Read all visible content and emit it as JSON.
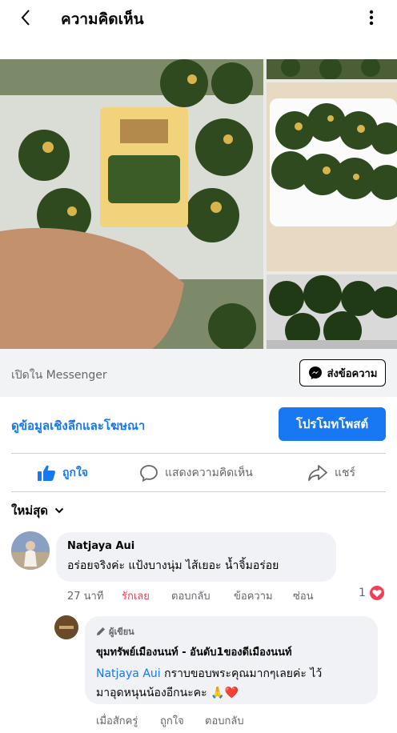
{
  "header": {
    "title": "ความคิดเห็น"
  },
  "messenger": {
    "open_text": "เปิดใน Messenger",
    "send_label": "ส่งข้อความ"
  },
  "promo": {
    "insights_label": "ดูข้อมูลเชิงลึกและโฆษณา",
    "promote_label": "โปรโมทโพสต์"
  },
  "actions": {
    "like": "ถูกใจ",
    "comment": "แสดงความคิดเห็น",
    "share": "แชร์"
  },
  "sort": {
    "label": "ใหม่สุด"
  },
  "comment1": {
    "author": "Natjaya Aui",
    "text": "อร่อยจริงค่ะ แป้งบางนุ่ม ไส้เยอะ น้ำจิ้มอร่อย",
    "time": "27 นาที",
    "reaction": "รักเลย",
    "reply": "ตอบกลับ",
    "message": "ข้อความ",
    "hide": "ซ่อน",
    "reaction_count": "1"
  },
  "comment2": {
    "badge": "ผู้เขียน",
    "author": "ขุมทรัพย์เมืองนนท์ - อันดับ1ของดีเมืองนนท์",
    "mention": "Natjaya Aui",
    "text_line1": " กราบขอบพระคุณมากๆเลยค่ะ ไว้",
    "text_line2": "มาอุดหนุนน้องอีกนะคะ 🙏❤️",
    "time": "เมื่อสักครู่",
    "like": "ถูกใจ",
    "reply": "ตอบกลับ"
  },
  "colors": {
    "accent": "#1877f2",
    "love": "#f33e58"
  }
}
